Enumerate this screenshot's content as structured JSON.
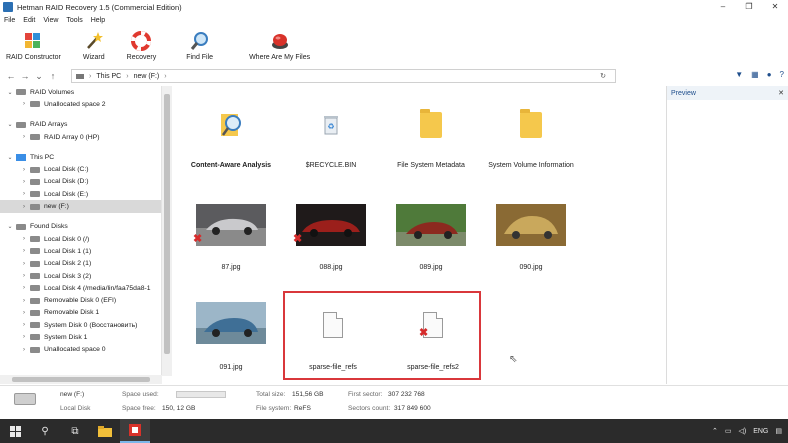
{
  "window": {
    "title": "Hetman RAID Recovery 1.5 (Commercial Edition)",
    "controls": [
      "–",
      "❐",
      "✕"
    ]
  },
  "menu": [
    "File",
    "Edit",
    "View",
    "Tools",
    "Help"
  ],
  "toolbar": [
    {
      "label": "RAID Constructor",
      "icon": "puzzle-icon"
    },
    {
      "label": "Wizard",
      "icon": "wand-icon"
    },
    {
      "label": "Recovery",
      "icon": "lifebuoy-icon"
    },
    {
      "label": "Find File",
      "icon": "magnifier-icon"
    },
    {
      "label": "Where Are My Files",
      "icon": "red-button-icon"
    }
  ],
  "address": {
    "crumbs": [
      "This PC",
      "new (F:)"
    ]
  },
  "tree": {
    "sections": [
      {
        "label": "RAID Volumes",
        "children": [
          "Unallocated space 2"
        ]
      },
      {
        "label": "RAID Arrays",
        "children": [
          "RAID Array 0 (HP)"
        ]
      },
      {
        "label": "This PC",
        "children": [
          "Local Disk (C:)",
          "Local Disk (D:)",
          "Local Disk (E:)",
          "new (F:)"
        ]
      },
      {
        "label": "Found Disks",
        "children": [
          "Local Disk 0 (/)",
          "Local Disk 1 (1)",
          "Local Disk 2 (1)",
          "Local Disk 3 (2)",
          "Local Disk 4 (/media/lin/faa75da8-1",
          "Removable Disk 0 (EFI)",
          "Removable Disk 1",
          "System Disk 0 (Восстановить)",
          "System Disk 1",
          "Unallocated space 0"
        ]
      }
    ],
    "selected": "new (F:)"
  },
  "files": [
    {
      "name": "Content-Aware Analysis",
      "type": "magnifier",
      "deleted": false,
      "bold": true
    },
    {
      "name": "$RECYCLE.BIN",
      "type": "recycle",
      "deleted": false,
      "bold": false
    },
    {
      "name": "File System Metadata",
      "type": "folder",
      "deleted": false,
      "bold": false
    },
    {
      "name": "System Volume Information",
      "type": "folder",
      "deleted": false,
      "bold": false
    },
    {
      "name": "87.jpg",
      "type": "image",
      "color": "#6d6d70",
      "deleted": true
    },
    {
      "name": "088.jpg",
      "type": "image",
      "color": "#7a1d1a",
      "deleted": true
    },
    {
      "name": "089.jpg",
      "type": "image",
      "color": "#8c2a1f",
      "deleted": false
    },
    {
      "name": "090.jpg",
      "type": "image",
      "color": "#b08a3c",
      "deleted": false
    },
    {
      "name": "091.jpg",
      "type": "image",
      "color": "#3f6f96",
      "deleted": false
    },
    {
      "name": "sparse-file_refs",
      "type": "doc",
      "deleted": false
    },
    {
      "name": "sparse-file_refs2",
      "type": "doc",
      "deleted": true
    }
  ],
  "preview": {
    "title": "Preview",
    "close": "✕"
  },
  "status": {
    "drive_name": "new (F:)",
    "drive_type": "Local Disk",
    "space_used_label": "Space used:",
    "space_free_label": "Space free:",
    "space_free": "150, 12 GB",
    "total_size_label": "Total size:",
    "total_size": "151,56 GB",
    "file_system_label": "File system:",
    "file_system": "ReFS",
    "first_sector_label": "First sector:",
    "first_sector": "307 232 768",
    "sectors_count_label": "Sectors count:",
    "sectors_count": "317 849 600"
  },
  "taskbar": {
    "lang": "ENG"
  }
}
